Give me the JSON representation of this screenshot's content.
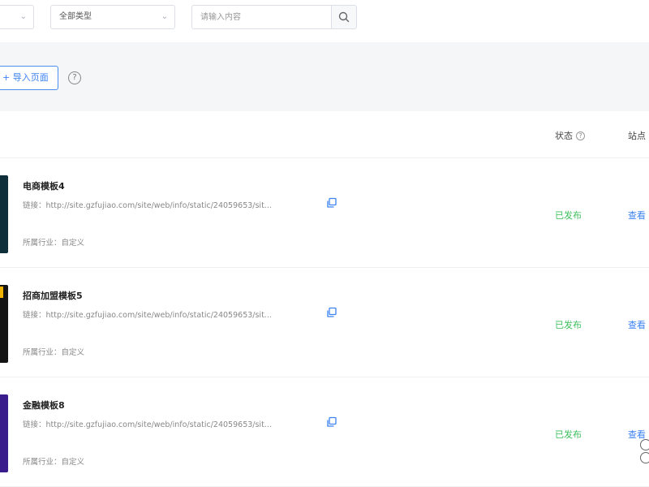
{
  "filters": {
    "first_select": "",
    "type_select": "全部类型",
    "search_placeholder": "请输入内容",
    "search_value": ""
  },
  "toolbar": {
    "import_label": "+ 导入页面",
    "help_glyph": "?"
  },
  "table": {
    "col_status": "状态",
    "col_action": "站点",
    "rows": [
      {
        "name": "电商模板4",
        "link": "链接：http://site.gzfujiao.com/site/web/info/static/24059653/sit...",
        "industry": "所属行业：自定义",
        "status": "已发布",
        "action": "查看",
        "thumb_color": "#0f2f3a"
      },
      {
        "name": "招商加盟模板5",
        "link": "链接：http://site.gzfujiao.com/site/web/info/static/24059653/sit...",
        "industry": "所属行业：自定义",
        "status": "已发布",
        "action": "查看",
        "thumb_color": "#141414"
      },
      {
        "name": "金融模板8",
        "link": "链接：http://site.gzfujiao.com/site/web/info/static/24059653/sit...",
        "industry": "所属行业：自定义",
        "status": "已发布",
        "action": "查看",
        "thumb_color": "#3a1c8c"
      }
    ]
  },
  "colors": {
    "accent": "#3b82f0",
    "status_published": "#3cbf5c",
    "toolbar_bg": "#f5f6f8"
  }
}
